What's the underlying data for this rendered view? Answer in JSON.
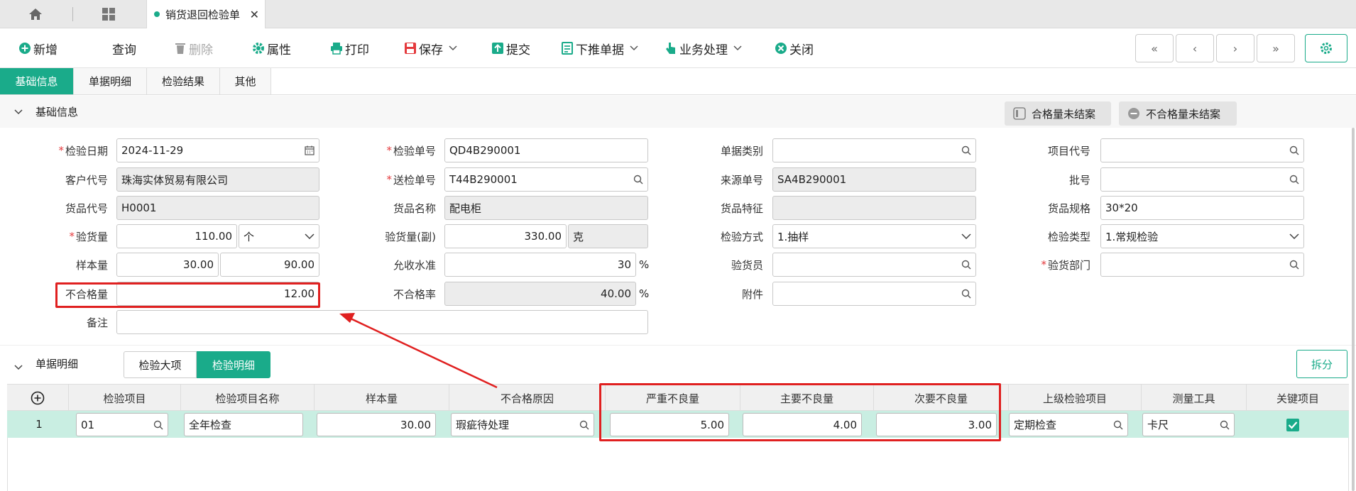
{
  "tabs": {
    "doc_tab_label": "销货退回检验单",
    "close_glyph": "✕"
  },
  "toolbar": {
    "new": "新增",
    "query": "查询",
    "delete": "删除",
    "props": "属性",
    "print": "打印",
    "save": "保存",
    "submit": "提交",
    "push_down": "下推单据",
    "business": "业务处理",
    "close": "关闭"
  },
  "subtabs": [
    "基础信息",
    "单据明细",
    "检验结果",
    "其他"
  ],
  "basic_section": {
    "title": "基础信息",
    "status_qualified": "合格量未结案",
    "status_unqualified": "不合格量未结案"
  },
  "form": {
    "inspect_date": {
      "label": "检验日期",
      "value": "2024-11-29"
    },
    "customer_code": {
      "label": "客户代号",
      "value": "珠海实体贸易有限公司"
    },
    "goods_code": {
      "label": "货品代号",
      "value": "H0001"
    },
    "inspect_qty": {
      "label": "验货量",
      "value": "110.00",
      "unit": "个"
    },
    "sample_qty": {
      "label": "样本量",
      "value": "30.00",
      "value2": "90.00"
    },
    "unqualified_qty": {
      "label": "不合格量",
      "value": "12.00"
    },
    "remark": {
      "label": "备注",
      "value": ""
    },
    "inspect_no": {
      "label": "检验单号",
      "value": "QD4B290001"
    },
    "send_no": {
      "label": "送检单号",
      "value": "T44B290001"
    },
    "goods_name": {
      "label": "货品名称",
      "value": "配电柜"
    },
    "inspect_qty_sub": {
      "label": "验货量(副)",
      "value": "330.00",
      "unit": "克"
    },
    "accept_level": {
      "label": "允收水准",
      "value": "30",
      "unit": "%"
    },
    "unqualified_rate": {
      "label": "不合格率",
      "value": "40.00",
      "unit": "%"
    },
    "doc_type": {
      "label": "单据类别",
      "value": ""
    },
    "source_no": {
      "label": "来源单号",
      "value": "SA4B290001"
    },
    "goods_feature": {
      "label": "货品特征",
      "value": ""
    },
    "inspect_method": {
      "label": "检验方式",
      "value": "1.抽样"
    },
    "inspector": {
      "label": "验货员",
      "value": ""
    },
    "attachment": {
      "label": "附件",
      "value": ""
    },
    "project_code": {
      "label": "项目代号",
      "value": ""
    },
    "batch_no": {
      "label": "批号",
      "value": ""
    },
    "goods_spec": {
      "label": "货品规格",
      "value": "30*20"
    },
    "inspect_type": {
      "label": "检验类型",
      "value": "1.常规检验"
    },
    "inspect_dept": {
      "label": "验货部门",
      "value": ""
    }
  },
  "detail_section": {
    "title": "单据明细",
    "pill_major": "检验大项",
    "pill_detail": "检验明细",
    "split": "拆分"
  },
  "table": {
    "headers": [
      "检验项目",
      "检验项目名称",
      "样本量",
      "不合格原因",
      "严重不良量",
      "主要不良量",
      "次要不良量",
      "上级检验项目",
      "测量工具",
      "关键项目"
    ],
    "rows": [
      {
        "no": "1",
        "item": "01",
        "item_name": "全年检查",
        "sample": "30.00",
        "reason": "瑕疵待处理",
        "critical": "5.00",
        "major": "4.00",
        "minor": "3.00",
        "parent": "定期检查",
        "tool": "卡尺",
        "key": true
      }
    ]
  },
  "colors": {
    "accent": "#1aab8a",
    "highlight": "#e02020",
    "row_selected": "#c9eee2"
  }
}
